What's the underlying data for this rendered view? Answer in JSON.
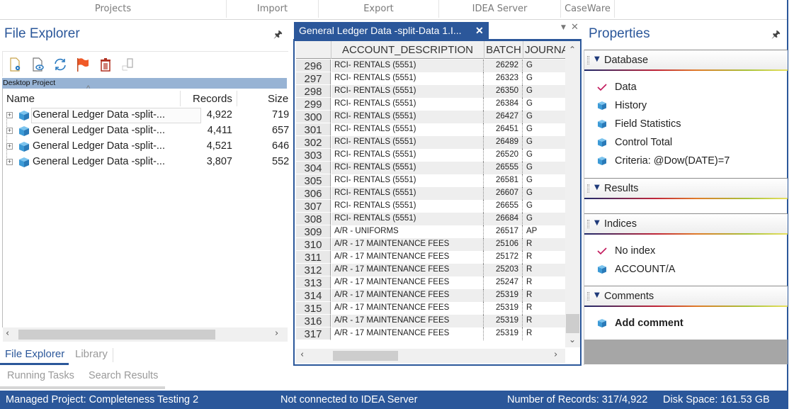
{
  "ribbon": {
    "tabs": [
      "Projects",
      "Import",
      "Export",
      "IDEA Server",
      "CaseWare"
    ]
  },
  "file_explorer": {
    "title": "File Explorer",
    "toolbar": [
      {
        "icon": "new-document-settings-icon"
      },
      {
        "icon": "view-document-icon"
      },
      {
        "icon": "refresh-icon"
      },
      {
        "icon": "flag-icon"
      },
      {
        "icon": "delete-icon"
      },
      {
        "icon": "device-icon"
      }
    ],
    "group": "Desktop Project",
    "columns": {
      "name": "Name",
      "records": "Records",
      "size": "Size"
    },
    "rows": [
      {
        "name": "General Ledger Data -split-...",
        "records": "4,922",
        "size": "719"
      },
      {
        "name": "General Ledger Data -split-...",
        "records": "4,411",
        "size": "657"
      },
      {
        "name": "General Ledger Data -split-...",
        "records": "4,521",
        "size": "646"
      },
      {
        "name": "General Ledger Data -split-...",
        "records": "3,807",
        "size": "552"
      }
    ],
    "tabs": [
      "File Explorer",
      "Library"
    ],
    "bottom_tabs": [
      "Running Tasks",
      "Search Results"
    ]
  },
  "document": {
    "tab_title": "General Ledger Data -split-Data 1.I...",
    "close_glyph": "✕",
    "columns": [
      "",
      "ACCOUNT_DESCRIPTION",
      "BATCH",
      "JOURNA"
    ],
    "rows": [
      {
        "num": "296",
        "desc": "RCI- RENTALS (5551)",
        "batch": "26292",
        "journal": "G"
      },
      {
        "num": "297",
        "desc": "RCI- RENTALS (5551)",
        "batch": "26323",
        "journal": "G"
      },
      {
        "num": "298",
        "desc": "RCI- RENTALS (5551)",
        "batch": "26350",
        "journal": "G"
      },
      {
        "num": "299",
        "desc": "RCI- RENTALS (5551)",
        "batch": "26384",
        "journal": "G"
      },
      {
        "num": "300",
        "desc": "RCI- RENTALS (5551)",
        "batch": "26427",
        "journal": "G"
      },
      {
        "num": "301",
        "desc": "RCI- RENTALS (5551)",
        "batch": "26451",
        "journal": "G"
      },
      {
        "num": "302",
        "desc": "RCI- RENTALS (5551)",
        "batch": "26489",
        "journal": "G"
      },
      {
        "num": "303",
        "desc": "RCI- RENTALS (5551)",
        "batch": "26520",
        "journal": "G"
      },
      {
        "num": "304",
        "desc": "RCI- RENTALS (5551)",
        "batch": "26555",
        "journal": "G"
      },
      {
        "num": "305",
        "desc": "RCI- RENTALS (5551)",
        "batch": "26581",
        "journal": "G"
      },
      {
        "num": "306",
        "desc": "RCI- RENTALS (5551)",
        "batch": "26607",
        "journal": "G"
      },
      {
        "num": "307",
        "desc": "RCI- RENTALS (5551)",
        "batch": "26655",
        "journal": "G"
      },
      {
        "num": "308",
        "desc": "RCI- RENTALS (5551)",
        "batch": "26684",
        "journal": "G"
      },
      {
        "num": "309",
        "desc": "A/R - UNIFORMS",
        "batch": "26517",
        "journal": "AP"
      },
      {
        "num": "310",
        "desc": "A/R - 17 MAINTENANCE FEES",
        "batch": "25106",
        "journal": "R"
      },
      {
        "num": "311",
        "desc": "A/R - 17 MAINTENANCE FEES",
        "batch": "25172",
        "journal": "R"
      },
      {
        "num": "312",
        "desc": "A/R - 17 MAINTENANCE FEES",
        "batch": "25203",
        "journal": "R"
      },
      {
        "num": "313",
        "desc": "A/R - 17 MAINTENANCE FEES",
        "batch": "25247",
        "journal": "R"
      },
      {
        "num": "314",
        "desc": "A/R - 17 MAINTENANCE FEES",
        "batch": "25319",
        "journal": "R"
      },
      {
        "num": "315",
        "desc": "A/R - 17 MAINTENANCE FEES",
        "batch": "25319",
        "journal": "R"
      },
      {
        "num": "316",
        "desc": "A/R - 17 MAINTENANCE FEES",
        "batch": "25319",
        "journal": "R"
      },
      {
        "num": "317",
        "desc": "A/R - 17 MAINTENANCE FEES",
        "batch": "25319",
        "journal": "R"
      }
    ]
  },
  "properties": {
    "title": "Properties",
    "sections": [
      {
        "label": "Database",
        "items": [
          {
            "icon": "check-icon",
            "text": "Data"
          },
          {
            "icon": "database-icon",
            "text": "History"
          },
          {
            "icon": "database-icon",
            "text": "Field Statistics"
          },
          {
            "icon": "database-icon",
            "text": "Control Total"
          },
          {
            "icon": "database-icon",
            "text": "Criteria: @Dow(DATE)=7"
          }
        ]
      },
      {
        "label": "Results",
        "items": []
      },
      {
        "label": "Indices",
        "items": [
          {
            "icon": "check-icon",
            "text": "No index"
          },
          {
            "icon": "database-icon",
            "text": "ACCOUNT/A"
          }
        ]
      },
      {
        "label": "Comments",
        "items": [
          {
            "icon": "database-icon",
            "text": "Add comment"
          }
        ]
      }
    ]
  },
  "status_bar": {
    "project": "Managed Project: Completeness Testing 2",
    "server": "Not connected to IDEA Server",
    "records": "Number of Records: 317/4,922",
    "disk": "Disk Space: 161.53 GB"
  },
  "colors": {
    "accent": "#2b579a",
    "group_header": "#97b3d4",
    "check": "#c2185b",
    "cube": "#3c9ad6",
    "flag": "#f05a28"
  }
}
